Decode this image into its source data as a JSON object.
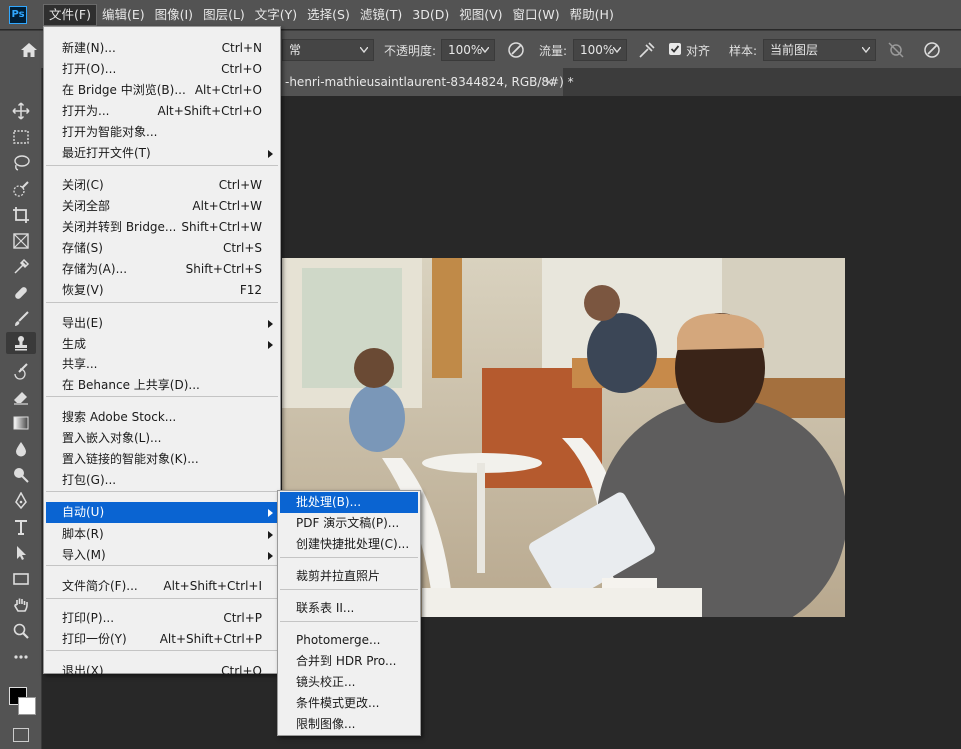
{
  "app": {
    "logo_text": "Ps"
  },
  "menubar": {
    "items": [
      "文件(F)",
      "编辑(E)",
      "图像(I)",
      "图层(L)",
      "文字(Y)",
      "选择(S)",
      "滤镜(T)",
      "3D(D)",
      "视图(V)",
      "窗口(W)",
      "帮助(H)"
    ]
  },
  "options": {
    "mode_value": "常",
    "opacity_label": "不透明度:",
    "opacity_value": "100%",
    "flow_label": "流量:",
    "flow_value": "100%",
    "align_label": "对齐",
    "sample_label": "样本:",
    "sample_value": "当前图层"
  },
  "document": {
    "tab_title": "-henri-mathieusaintlaurent-8344824, RGB/8#) *",
    "close_glyph": "×"
  },
  "file_menu": {
    "items": [
      {
        "label": "新建(N)...",
        "shortcut": "Ctrl+N"
      },
      {
        "label": "打开(O)...",
        "shortcut": "Ctrl+O"
      },
      {
        "label": "在 Bridge 中浏览(B)...",
        "shortcut": "Alt+Ctrl+O"
      },
      {
        "label": "打开为...",
        "shortcut": "Alt+Shift+Ctrl+O"
      },
      {
        "label": "打开为智能对象...",
        "shortcut": ""
      },
      {
        "label": "最近打开文件(T)",
        "shortcut": "",
        "submenu": true
      },
      {
        "label": "关闭(C)",
        "shortcut": "Ctrl+W"
      },
      {
        "label": "关闭全部",
        "shortcut": "Alt+Ctrl+W"
      },
      {
        "label": "关闭并转到 Bridge...",
        "shortcut": "Shift+Ctrl+W"
      },
      {
        "label": "存储(S)",
        "shortcut": "Ctrl+S"
      },
      {
        "label": "存储为(A)...",
        "shortcut": "Shift+Ctrl+S"
      },
      {
        "label": "恢复(V)",
        "shortcut": "F12"
      },
      {
        "label": "导出(E)",
        "shortcut": "",
        "submenu": true
      },
      {
        "label": "生成",
        "shortcut": "",
        "submenu": true
      },
      {
        "label": "共享...",
        "shortcut": ""
      },
      {
        "label": "在 Behance 上共享(D)...",
        "shortcut": ""
      },
      {
        "label": "搜索 Adobe Stock...",
        "shortcut": ""
      },
      {
        "label": "置入嵌入对象(L)...",
        "shortcut": ""
      },
      {
        "label": "置入链接的智能对象(K)...",
        "shortcut": ""
      },
      {
        "label": "打包(G)...",
        "shortcut": ""
      },
      {
        "label": "自动(U)",
        "shortcut": "",
        "submenu": true,
        "highlighted": true
      },
      {
        "label": "脚本(R)",
        "shortcut": "",
        "submenu": true
      },
      {
        "label": "导入(M)",
        "shortcut": "",
        "submenu": true
      },
      {
        "label": "文件简介(F)...",
        "shortcut": "Alt+Shift+Ctrl+I"
      },
      {
        "label": "打印(P)...",
        "shortcut": "Ctrl+P"
      },
      {
        "label": "打印一份(Y)",
        "shortcut": "Alt+Shift+Ctrl+P"
      },
      {
        "label": "退出(X)",
        "shortcut": "Ctrl+Q"
      }
    ]
  },
  "automate_menu": {
    "items": [
      {
        "label": "批处理(B)...",
        "highlighted": true
      },
      {
        "label": "PDF 演示文稿(P)..."
      },
      {
        "label": "创建快捷批处理(C)..."
      },
      {
        "label": "裁剪并拉直照片"
      },
      {
        "label": "联系表 II..."
      },
      {
        "label": "Photomerge..."
      },
      {
        "label": "合并到 HDR Pro..."
      },
      {
        "label": "镜头校正..."
      },
      {
        "label": "条件模式更改..."
      },
      {
        "label": "限制图像..."
      }
    ]
  },
  "colors": {
    "highlight": "#0a64d2",
    "chrome": "#535353",
    "canvas_bg": "#282828"
  }
}
